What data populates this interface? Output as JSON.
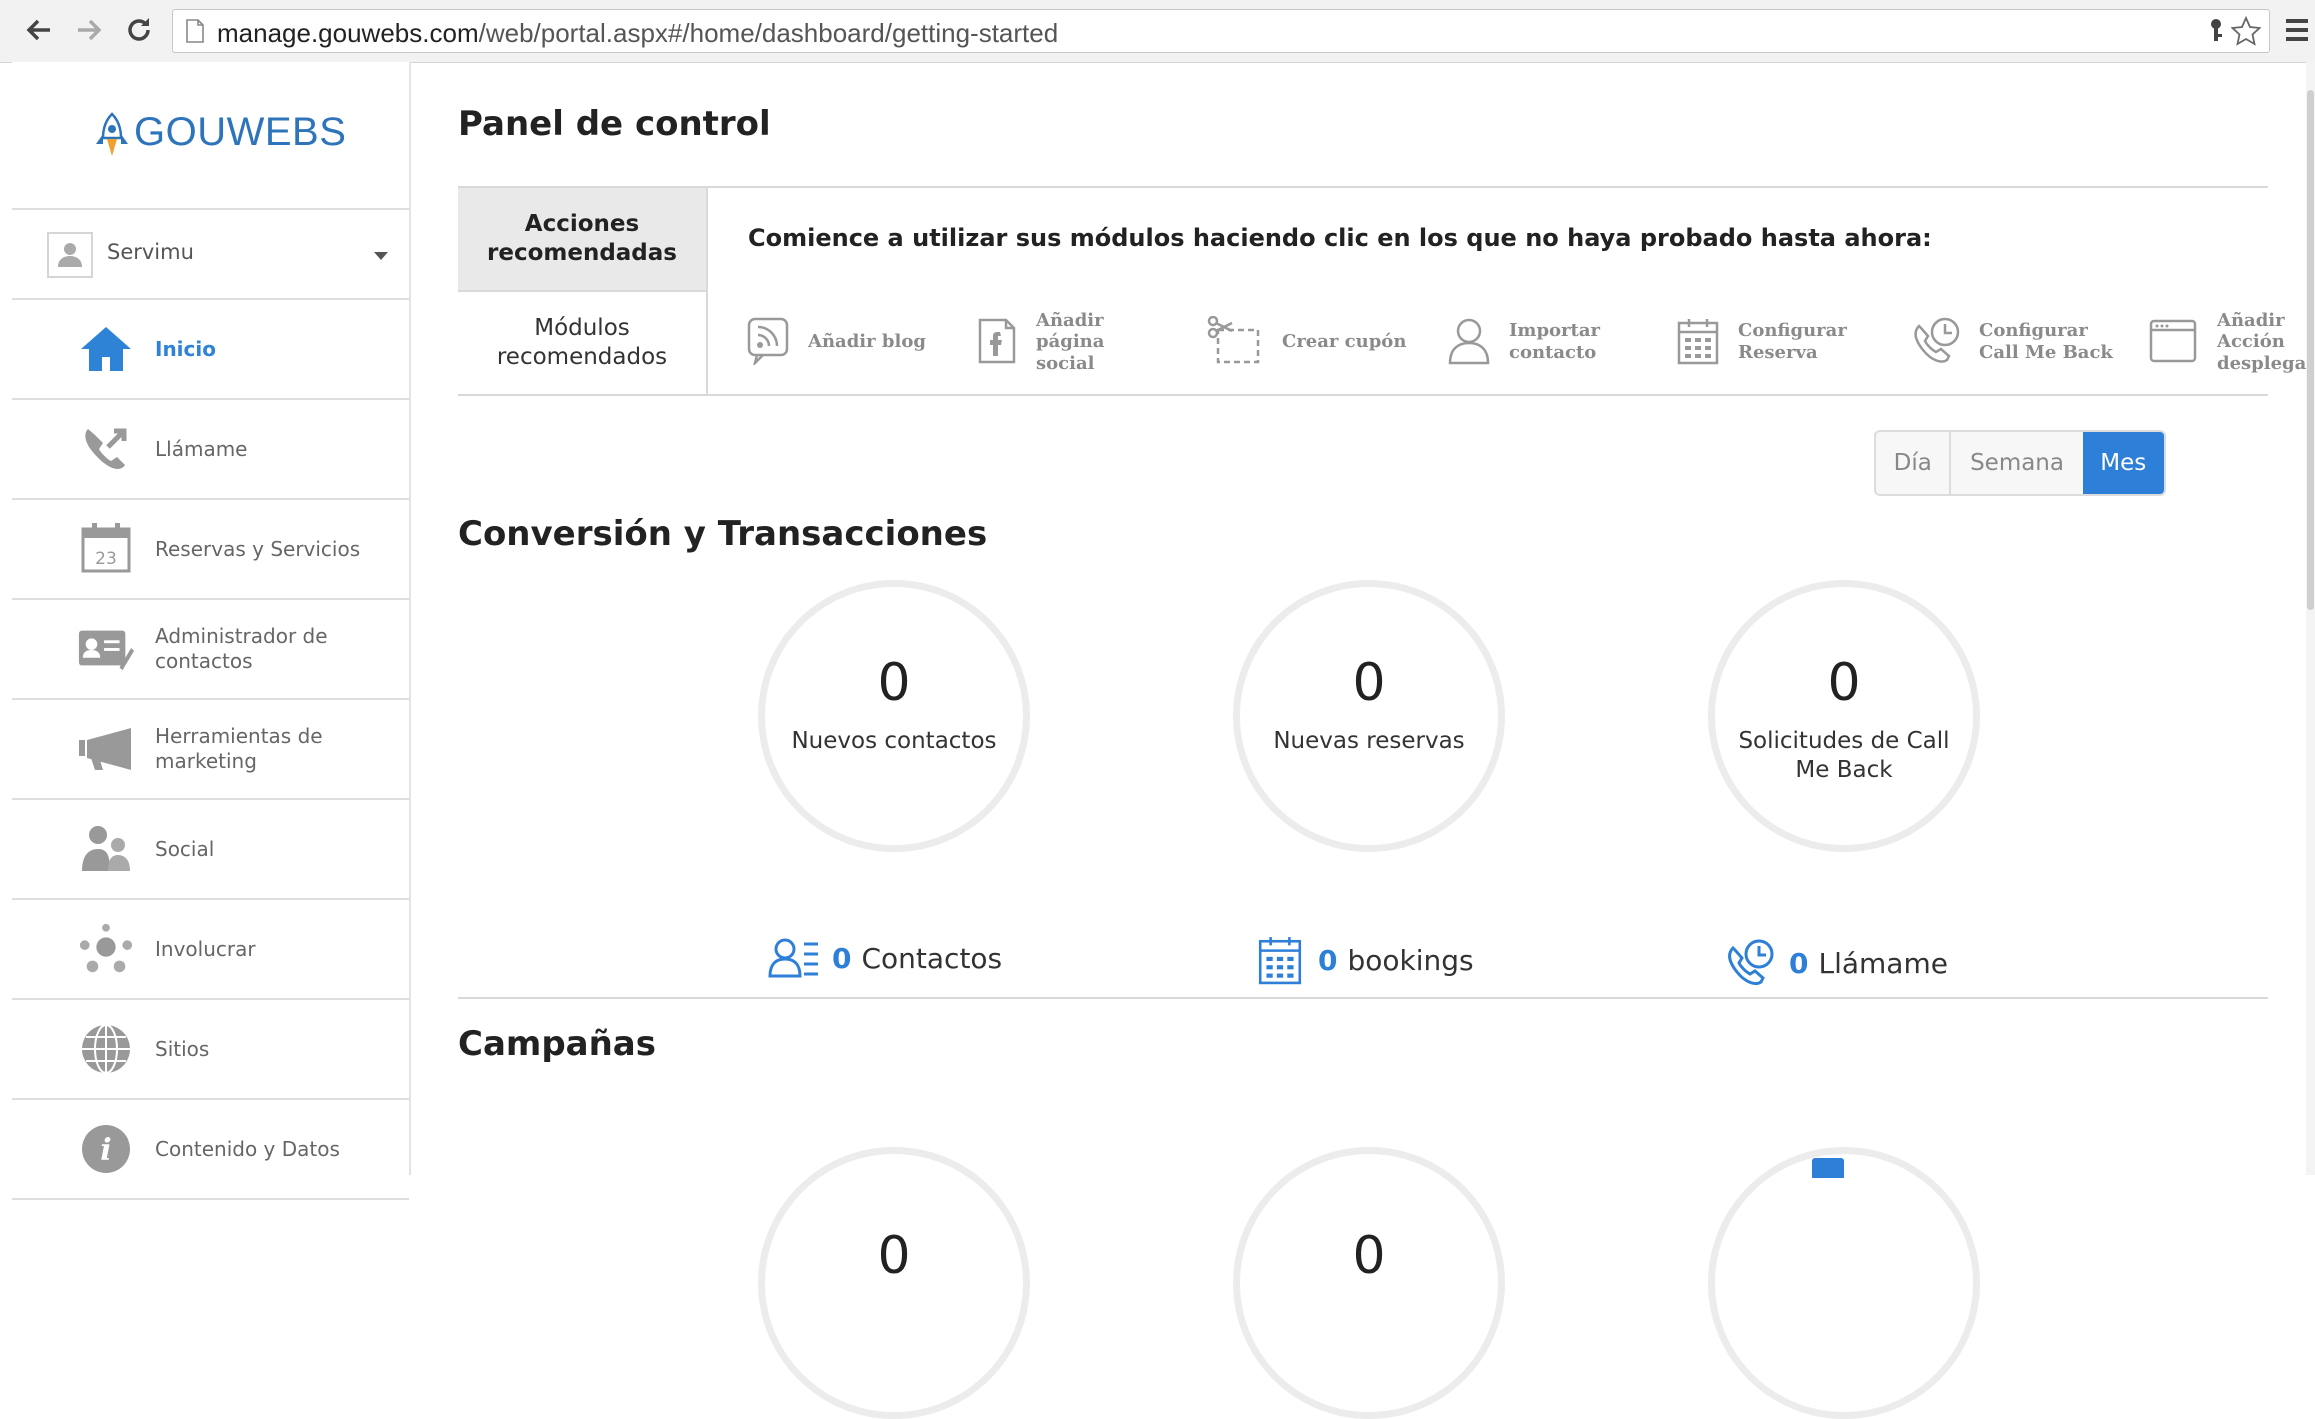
{
  "browser": {
    "url_host": "manage.gouwebs.com",
    "url_path": "/web/portal.aspx#/home/dashboard/getting-started"
  },
  "sidebar": {
    "logo": "GOUWEBS",
    "account": "Servimu",
    "items": [
      {
        "label": "Inicio",
        "icon": "home-icon",
        "active": true
      },
      {
        "label": "Llámame",
        "icon": "phone-callback-icon"
      },
      {
        "label": "Reservas y Servicios",
        "icon": "calendar-icon",
        "icon_text": "23"
      },
      {
        "label": "Administrador de contactos",
        "icon": "contact-card-icon"
      },
      {
        "label": "Herramientas de marketing",
        "icon": "megaphone-icon"
      },
      {
        "label": "Social",
        "icon": "people-icon"
      },
      {
        "label": "Involucrar",
        "icon": "network-icon"
      },
      {
        "label": "Sitios",
        "icon": "globe-icon"
      },
      {
        "label": "Contenido y Datos",
        "icon": "info-icon"
      }
    ]
  },
  "main": {
    "title": "Panel de control",
    "tabs": {
      "recommended_actions": "Acciones recomendadas",
      "recommended_modules": "Módulos recomendados"
    },
    "prompt": "Comience a utilizar sus módulos haciendo clic en los que no haya probado hasta ahora:",
    "modules": [
      {
        "label": "Añadir blog",
        "icon": "rss-icon"
      },
      {
        "label": "Añadir página social",
        "icon": "facebook-icon"
      },
      {
        "label": "Crear cupón",
        "icon": "scissors-coupon-icon"
      },
      {
        "label": "Importar contacto",
        "icon": "person-icon"
      },
      {
        "label": "Configurar Reserva",
        "icon": "calendar-grid-icon"
      },
      {
        "label": "Configurar Call Me Back",
        "icon": "phone-clock-icon"
      },
      {
        "label": "Añadir Acción desplega",
        "icon": "window-icon"
      }
    ],
    "period": {
      "day": "Día",
      "week": "Semana",
      "month": "Mes",
      "selected": "Mes"
    },
    "conversion": {
      "title": "Conversión y Transacciones",
      "stats": [
        {
          "value": "0",
          "label": "Nuevos contactos"
        },
        {
          "value": "0",
          "label": "Nuevas reservas"
        },
        {
          "value": "0",
          "label": "Solicitudes de Call Me Back"
        }
      ],
      "summaries": [
        {
          "value": "0",
          "label": "Contactos",
          "icon": "contacts-list-icon"
        },
        {
          "value": "0",
          "label": "bookings",
          "icon": "calendar-grid-icon"
        },
        {
          "value": "0",
          "label": "Llámame",
          "icon": "phone-clock-icon"
        }
      ]
    },
    "campaigns": {
      "title": "Campañas",
      "stats": [
        {
          "value": "0"
        },
        {
          "value": "0"
        }
      ]
    }
  },
  "colors": {
    "accent": "#2e7fd8",
    "logo": "#2e74bb"
  }
}
